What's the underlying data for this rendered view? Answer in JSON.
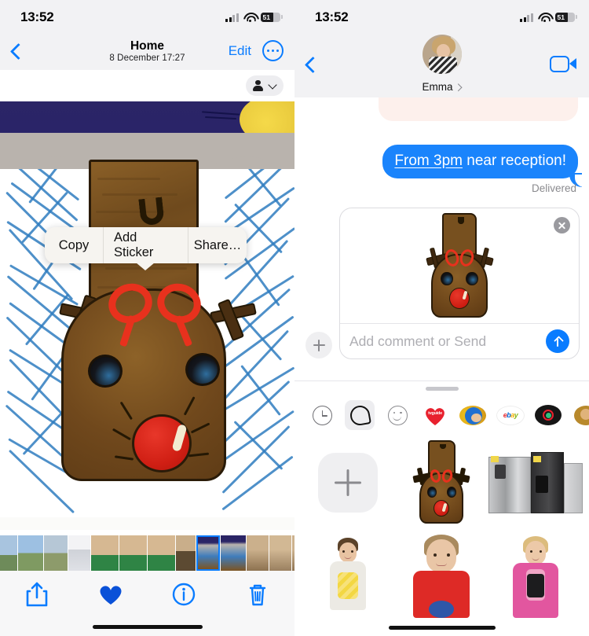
{
  "left_panel": {
    "app": "Photos",
    "status_bar": {
      "time": "13:52",
      "battery_level": "51",
      "wifi_icon": "wifi-icon",
      "cellular_icon": "cellular-bars-icon"
    },
    "nav": {
      "back_icon": "chevron-left-icon",
      "title": "Home",
      "subtitle": "8 December  17:27",
      "edit_label": "Edit",
      "more_icon": "ellipsis-circle-icon"
    },
    "people_chip": {
      "person_icon": "person-icon",
      "chevron_icon": "chevron-down-icon"
    },
    "context_menu": {
      "items": [
        {
          "label": "Copy",
          "name": "copy"
        },
        {
          "label": "Add Sticker",
          "name": "add-sticker"
        },
        {
          "label": "Share…",
          "name": "share"
        }
      ]
    },
    "photo": {
      "description": "Child's painting of a reindeer with red nose, red bow and stick antlers on blue scribbled background with night sky and yellow moon",
      "sky_color": "#2b2566",
      "moon_color": "#e8c93c",
      "cloud_color": "#b9b3ad",
      "scribble_color": "#2f7cc0",
      "body_color": "#70481c",
      "nose_color": "#d01f14",
      "bow_color": "#e8311d"
    },
    "toolbar": {
      "share_icon": "share-icon",
      "favorite_icon": "heart-filled-icon",
      "info_icon": "info-circle-icon",
      "delete_icon": "trash-icon",
      "accent_color": "#0a7cff"
    },
    "filmstrip": {
      "selected_index": 8,
      "thumbs": [
        "field-1",
        "field-2",
        "field-3",
        "messages-screenshot",
        "girl-plate-1",
        "girl-plate-2",
        "girl-plate-3",
        "girl-holding-art",
        "reindeer-drawing-selected",
        "reindeer-drawing",
        "girl-1",
        "girl-2",
        "girl-3",
        "boy-telescope-1",
        "boy-telescope-2",
        "girl-tie-1",
        "girl-tie-2"
      ]
    },
    "home_indicator": "home-indicator"
  },
  "right_panel": {
    "app": "Messages",
    "status_bar": {
      "time": "13:52",
      "battery_level": "51",
      "wifi_icon": "wifi-icon",
      "cellular_icon": "cellular-bars-icon"
    },
    "nav": {
      "back_icon": "chevron-left-icon",
      "contact_name": "Emma",
      "contact_chevron_icon": "chevron-right-icon",
      "avatar": "contact-avatar",
      "facetime_icon": "facetime-video-icon"
    },
    "thread": {
      "partial_bubble_color": "#fdf0ec",
      "outgoing_message": {
        "link_text": "From 3pm",
        "rest_text": " near reception!",
        "full_text": "From 3pm near reception!",
        "bubble_color": "#1a84fc"
      },
      "status": "Delivered"
    },
    "sticker_card": {
      "close_icon": "close-circle-icon",
      "preview": "reindeer-sticker",
      "input_placeholder": "Add comment or Send",
      "input_value": "",
      "send_icon": "send-arrow-up-icon",
      "plus_icon": "plus-circle-icon"
    },
    "drawer": {
      "grabber": "drag-handle",
      "apps": [
        {
          "name": "recents-app",
          "icon": "clock-icon",
          "selected": false
        },
        {
          "name": "stickers-app",
          "icon": "sticker-icon",
          "selected": true
        },
        {
          "name": "emoji-app",
          "icon": "smiley-icon",
          "selected": false
        },
        {
          "name": "tvguide-app",
          "icon": "red-heart-icon",
          "label": "tvguide",
          "selected": false
        },
        {
          "name": "sonic-app",
          "icon": "sonic-icon",
          "selected": false
        },
        {
          "name": "ebay-app",
          "icon": "ebay-icon",
          "label": "ebay",
          "selected": false
        },
        {
          "name": "vinyl-app",
          "icon": "record-icon",
          "selected": false
        },
        {
          "name": "more-app",
          "icon": "avatar-icon",
          "selected": false
        }
      ],
      "stickers": [
        {
          "name": "add-sticker-tile",
          "type": "add"
        },
        {
          "name": "reindeer-sticker",
          "type": "reindeer"
        },
        {
          "name": "fridges-sticker",
          "type": "fridge"
        },
        {
          "name": "boy-yellow-shirt-sticker",
          "type": "kid-a"
        },
        {
          "name": "boy-red-shirt-sticker",
          "type": "kid-b"
        },
        {
          "name": "girl-pink-sticker",
          "type": "kid-c"
        }
      ]
    },
    "home_indicator": "home-indicator"
  }
}
